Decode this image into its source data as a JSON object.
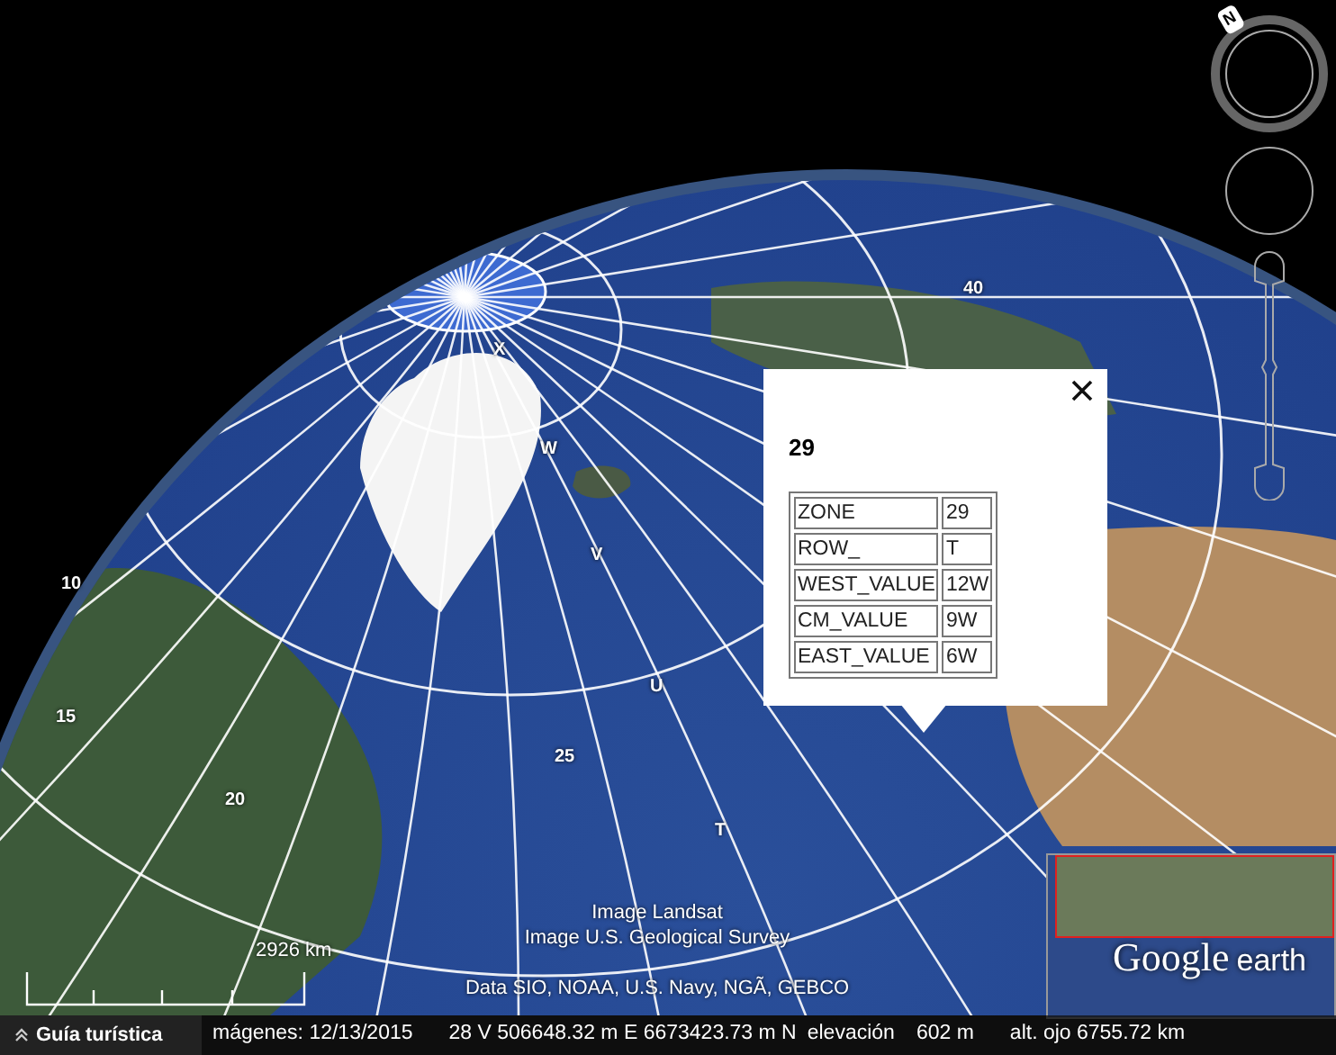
{
  "map_labels": [
    {
      "text": "X"
    },
    {
      "text": "W"
    },
    {
      "text": "V"
    },
    {
      "text": "U"
    },
    {
      "text": "T"
    },
    {
      "text": "25"
    },
    {
      "text": "20"
    },
    {
      "text": "15"
    },
    {
      "text": "10"
    },
    {
      "text": "40"
    }
  ],
  "popup": {
    "title": "29",
    "rows": [
      {
        "field": "ZONE",
        "value": "29"
      },
      {
        "field": "ROW_",
        "value": "T"
      },
      {
        "field": "WEST_VALUE",
        "value": "12W"
      },
      {
        "field": "CM_VALUE",
        "value": "9W"
      },
      {
        "field": "EAST_VALUE",
        "value": "6W"
      }
    ]
  },
  "compass_north": "N",
  "attribution": [
    "Image Landsat",
    "Image U.S. Geological Survey",
    "Data SIO, NOAA, U.S. Navy, NGÃ, GEBCO"
  ],
  "scale": "2926 km",
  "overview": {
    "logo_google": "Google",
    "logo_earth": "earth"
  },
  "status_bar": {
    "tour_button": "Guía turística",
    "imagery_date": "mágenes: 12/13/2015",
    "coordinates": "28 V 506648.32 m E 6673423.73 m N",
    "elevation_label": "elevación",
    "elevation": "602 m",
    "eye_altitude": "alt. ojo 6755.72 km"
  }
}
